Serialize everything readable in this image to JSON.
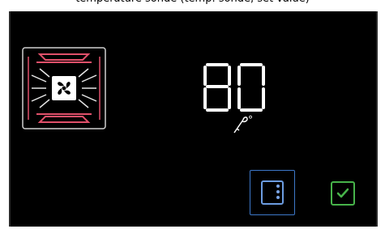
{
  "caption": "temperature sonde (temp. sonde, set value)",
  "mode": {
    "icon": "fan-with-top-bottom-heat-icon"
  },
  "temperature": {
    "value": "80",
    "probe_icon": "core-probe-icon",
    "unit": "°"
  },
  "door_button": {
    "icon": "door-icon"
  },
  "confirm_button": {
    "icon": "checkmark-icon"
  },
  "colors": {
    "background": "#000000",
    "heater": "#e0506a",
    "display": "#ffffff",
    "door_accent": "#3d78c9",
    "confirm_accent": "#47b34a"
  }
}
